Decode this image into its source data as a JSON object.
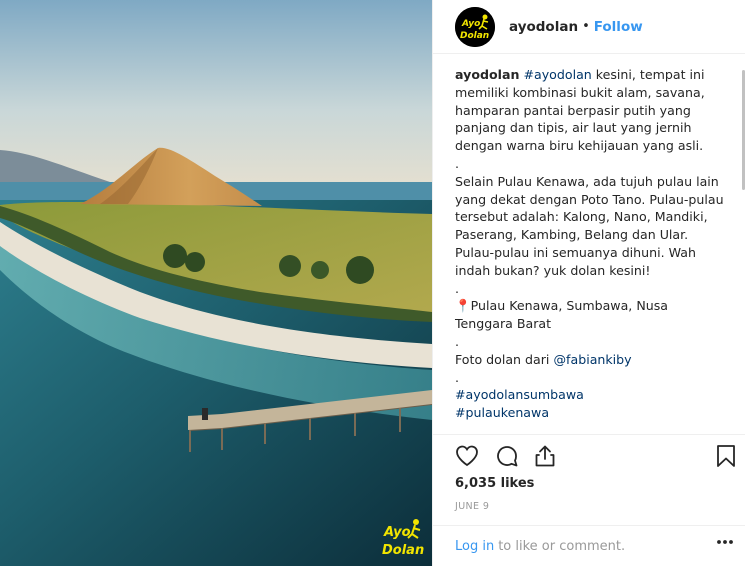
{
  "post": {
    "username": "ayodolan",
    "separator": "•",
    "follow_label": "Follow",
    "avatar_text_line1": "Ayo",
    "avatar_text_line2": "Dolan",
    "watermark_line1": "Ayo",
    "watermark_line2": "Dolan"
  },
  "caption": {
    "author": "ayodolan",
    "hashtag1": "#ayodolan",
    "text1": " kesini, tempat ini memiliki kombinasi bukit alam, savana, hamparan pantai berpasir putih yang panjang dan tipis, air laut yang jernih dengan warna biru kehijauan yang asli.",
    "dot1": ".",
    "text2": "Selain Pulau Kenawa, ada tujuh pulau lain yang dekat dengan Poto Tano. Pulau-pulau tersebut adalah: Kalong, Nano, Mandiki, Paserang, Kambing, Belang dan Ular. Pulau-pulau ini semuanya dihuni. Wah indah bukan? yuk dolan kesini!",
    "dot2": ".",
    "location": "📍Pulau Kenawa, Sumbawa, Nusa Tenggara Barat",
    "dot3": ".",
    "credit_prefix": "Foto dolan dari ",
    "credit_user": "@fabiankiby",
    "dot4": ".",
    "hashtag2": "#ayodolansumbawa",
    "hashtag3": "#pulaukenawa"
  },
  "actions": {
    "icons": [
      "heart-icon",
      "comment-icon",
      "share-icon",
      "bookmark-icon"
    ]
  },
  "stats": {
    "likes": "6,035 likes",
    "date": "JUNE 9"
  },
  "footer": {
    "login_label": "Log in",
    "login_suffix": "to like or comment.",
    "more_icon": "more-options-icon"
  },
  "colors": {
    "link": "#3897f0",
    "hashtag": "#003569",
    "text": "#262626",
    "muted": "#999999",
    "watermark": "#f2e500"
  }
}
